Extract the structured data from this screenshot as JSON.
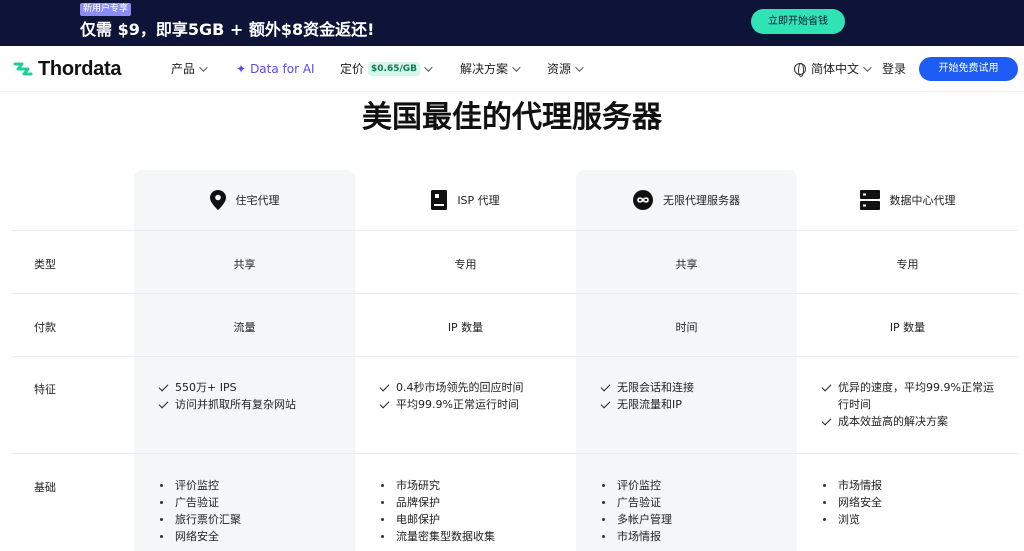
{
  "promo": {
    "badge": "新用户专享",
    "text": "仅需 $9，即享5GB + 额外$8资金返还!",
    "cta": "立即开始省钱"
  },
  "nav": {
    "logo": "Thordata",
    "items": [
      {
        "label": "产品"
      },
      {
        "label": "Data for AI"
      },
      {
        "label": "定价",
        "badge": "$0.65/GB"
      },
      {
        "label": "解决方案"
      },
      {
        "label": "资源"
      }
    ],
    "language": "简体中文",
    "login": "登录",
    "signup": "开始免费试用"
  },
  "page": {
    "title": "美国最佳的代理服务器"
  },
  "table": {
    "columns": [
      {
        "name": "住宅代理",
        "icon": "map-pin-icon"
      },
      {
        "name": "ISP 代理",
        "icon": "server-card-icon"
      },
      {
        "name": "无限代理服务器",
        "icon": "infinity-icon"
      },
      {
        "name": "数据中心代理",
        "icon": "server-rack-icon"
      }
    ],
    "rows": {
      "type": {
        "label": "类型",
        "values": [
          "共享",
          "专用",
          "共享",
          "专用"
        ]
      },
      "payment": {
        "label": "付款",
        "values": [
          "流量",
          "IP 数量",
          "时间",
          "IP 数量"
        ]
      },
      "features": {
        "label": "特征",
        "values": [
          [
            "550万+ IPS",
            "访问并抓取所有复杂网站"
          ],
          [
            "0.4秒市场领先的回应时间",
            "平均99.9%正常运行时间"
          ],
          [
            "无限会话和连接",
            "无限流量和IP"
          ],
          [
            "优异的速度，平均99.9%正常运",
            "行时间",
            "成本效益高的解决方案"
          ]
        ]
      },
      "basics": {
        "label": "基础",
        "values": [
          [
            "评价监控",
            "广告验证",
            "旅行票价汇聚",
            "网络安全"
          ],
          [
            "市场研究",
            "品牌保护",
            "电邮保护",
            "流量密集型数据收集"
          ],
          [
            "评价监控",
            "广告验证",
            "多帐户管理",
            "市场情报"
          ],
          [
            "市场情报",
            "网络安全",
            "浏览"
          ]
        ]
      }
    }
  }
}
